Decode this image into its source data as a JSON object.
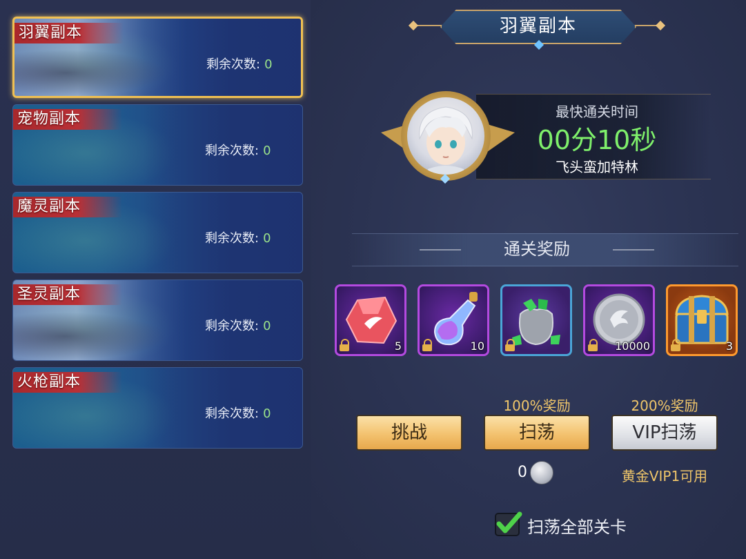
{
  "dungeons": [
    {
      "name": "羽翼副本",
      "remain_label": "剩余次数:",
      "remain": "0",
      "active": true
    },
    {
      "name": "宠物副本",
      "remain_label": "剩余次数:",
      "remain": "0",
      "active": false
    },
    {
      "name": "魔灵副本",
      "remain_label": "剩余次数:",
      "remain": "0",
      "active": false
    },
    {
      "name": "圣灵副本",
      "remain_label": "剩余次数:",
      "remain": "0",
      "active": false
    },
    {
      "name": "火枪副本",
      "remain_label": "剩余次数:",
      "remain": "0",
      "active": false
    }
  ],
  "panel": {
    "title": "羽翼副本",
    "record_label": "最快通关时间",
    "record_time": "00分10秒",
    "record_player": "飞头蛮加特林",
    "reward_title": "通关奖励"
  },
  "rewards": [
    {
      "icon": "red-crystal-icon",
      "qty": "5",
      "rarity": "purple"
    },
    {
      "icon": "potion-bottle-icon",
      "qty": "10",
      "rarity": "purple"
    },
    {
      "icon": "gem-bag-icon",
      "qty": "",
      "rarity": "blue"
    },
    {
      "icon": "silver-coin-icon",
      "qty": "10000",
      "rarity": "purple"
    },
    {
      "icon": "treasure-chest-icon",
      "qty": "3",
      "rarity": "orange"
    }
  ],
  "actions": {
    "challenge": "挑战",
    "sweep": "扫荡",
    "sweep_bonus": "100%奖励",
    "sweep_cost": "0",
    "vip_sweep": "VIP扫荡",
    "vip_bonus": "200%奖励",
    "vip_note": "黄金VIP1可用"
  },
  "sweep_all": {
    "label": "扫荡全部关卡",
    "checked": true
  },
  "colors": {
    "accent_gold": "#f0c052",
    "record_green": "#7ff06b",
    "tag_red": "#a8282c"
  }
}
